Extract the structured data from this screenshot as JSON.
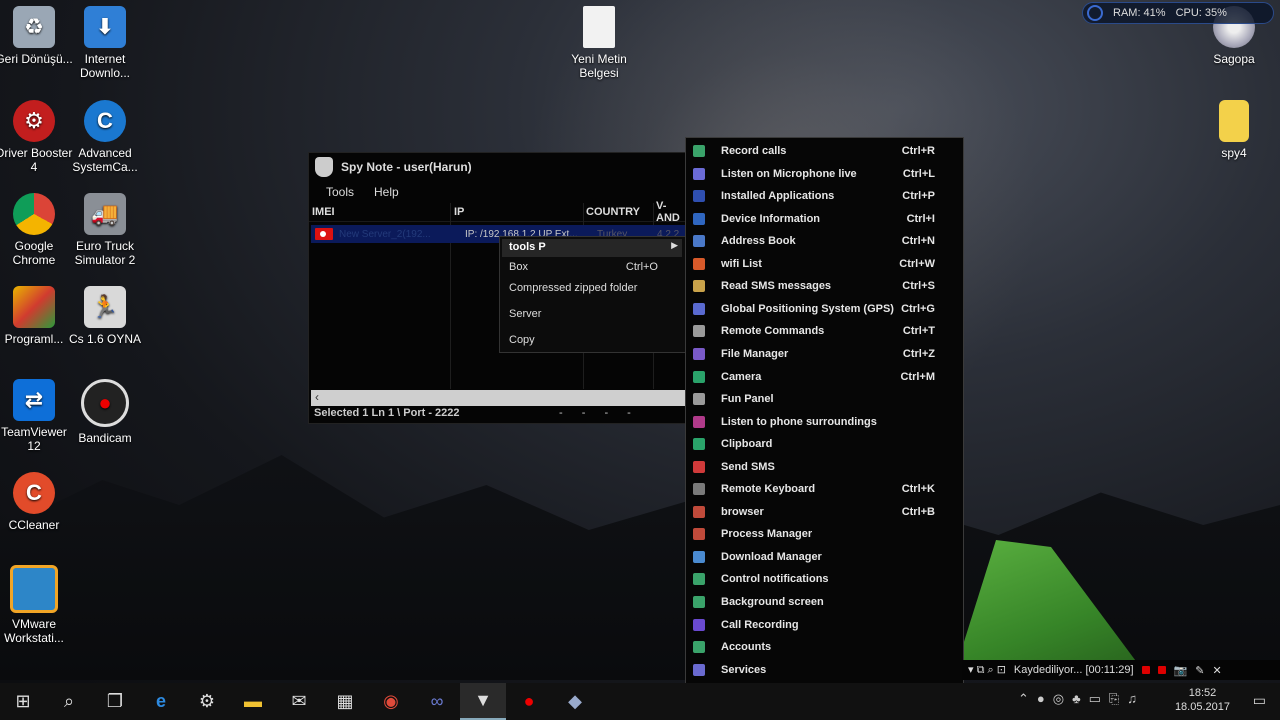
{
  "desktop_icons": [
    {
      "label": "Geri Dönüşü...",
      "icon": "recycle-bin-icon"
    },
    {
      "label": "Internet Downlo...",
      "icon": "internet-download-manager-icon"
    },
    {
      "label": "Driver Booster 4",
      "icon": "driver-booster-icon"
    },
    {
      "label": "Advanced SystemCa...",
      "icon": "advanced-systemcare-icon"
    },
    {
      "label": "Google Chrome",
      "icon": "chrome-icon"
    },
    {
      "label": "Euro Truck Simulator 2",
      "icon": "euro-truck-icon"
    },
    {
      "label": "Programl...",
      "icon": "programs-icon"
    },
    {
      "label": "Cs 1.6 OYNA",
      "icon": "counter-strike-icon"
    },
    {
      "label": "TeamViewer 12",
      "icon": "teamviewer-icon"
    },
    {
      "label": "Bandicam",
      "icon": "bandicam-icon"
    },
    {
      "label": "CCleaner",
      "icon": "ccleaner-icon"
    },
    {
      "label": "VMware Workstati...",
      "icon": "vmware-icon"
    },
    {
      "label": "Yeni Metin Belgesi",
      "icon": "text-document-icon"
    },
    {
      "label": "Sagopa",
      "icon": "sagopa-icon"
    },
    {
      "label": "spy4",
      "icon": "winrar-archive-icon"
    }
  ],
  "perf": {
    "ram": "RAM: 41%",
    "cpu": "CPU: 35%"
  },
  "spynote": {
    "title": "Spy Note - user(Harun)",
    "menu": [
      "Tools",
      "Help"
    ],
    "columns": [
      "IMEI",
      "IP",
      "COUNTRY",
      "V-AND"
    ],
    "row": {
      "imei": "New Server_2(192...",
      "ip": "IP: /192.168.1.2 UP Ext...",
      "country": "Turkey",
      "vand": "4.2.2"
    },
    "status": "Selected 1   Ln 1   \\ Port - 2222",
    "status_right": "- - - -"
  },
  "context_menu_1": [
    {
      "label": "tools P",
      "shortcut": "",
      "submenu": true
    },
    {
      "label": "Box",
      "shortcut": "Ctrl+O"
    },
    {
      "label": "Compressed zipped folder",
      "shortcut": ""
    },
    {
      "label": "Server",
      "shortcut": "",
      "submenu": true
    },
    {
      "label": "Copy",
      "shortcut": "",
      "submenu": true
    }
  ],
  "context_menu_2": [
    {
      "label": "Record calls",
      "shortcut": "Ctrl+R",
      "icon": "phone-icon",
      "color": "#3aa36a"
    },
    {
      "label": "Listen on Microphone live",
      "shortcut": "Ctrl+L",
      "icon": "headphones-icon",
      "color": "#6b6bd6"
    },
    {
      "label": "Installed Applications",
      "shortcut": "Ctrl+P",
      "icon": "play-store-icon",
      "color": "#2f4fb0"
    },
    {
      "label": "Device Information",
      "shortcut": "Ctrl+I",
      "icon": "device-info-icon",
      "color": "#2f66c0"
    },
    {
      "label": "Address Book",
      "shortcut": "Ctrl+N",
      "icon": "address-book-icon",
      "color": "#4a78c8"
    },
    {
      "label": "wifi List",
      "shortcut": "Ctrl+W",
      "icon": "wifi-icon",
      "color": "#d85a2a"
    },
    {
      "label": "Read SMS  messages",
      "shortcut": "Ctrl+S",
      "icon": "envelope-icon",
      "color": "#c9a24a"
    },
    {
      "label": "Global Positioning System (GPS)",
      "shortcut": "Ctrl+G",
      "icon": "gps-icon",
      "color": "#5a6ad0"
    },
    {
      "label": "Remote Commands",
      "shortcut": "Ctrl+T",
      "icon": "braces-icon",
      "color": "#9a9a9a"
    },
    {
      "label": "File Manager",
      "shortcut": "Ctrl+Z",
      "icon": "folder-icon",
      "color": "#7a5ac8"
    },
    {
      "label": "Camera",
      "shortcut": "Ctrl+M",
      "icon": "camera-icon",
      "color": "#2aa36a"
    },
    {
      "label": "Fun Panel",
      "shortcut": "",
      "icon": "ghost-icon",
      "color": "#9a9a9a"
    },
    {
      "label": "Listen to phone surroundings",
      "shortcut": "",
      "icon": "microphone-icon",
      "color": "#b03a8a"
    },
    {
      "label": "Clipboard",
      "shortcut": "",
      "icon": "clipboard-icon",
      "color": "#2aa36a"
    },
    {
      "label": "Send SMS",
      "shortcut": "",
      "icon": "sms-card-icon",
      "color": "#d03a3a"
    },
    {
      "label": "Remote Keyboard",
      "shortcut": "Ctrl+K",
      "icon": "keypad-icon",
      "color": "#7a7a7a"
    },
    {
      "label": "browser",
      "shortcut": "Ctrl+B",
      "icon": "globe-icon",
      "color": "#c04a3a"
    },
    {
      "label": "Process Manager",
      "shortcut": "",
      "icon": "gear-icon",
      "color": "#c04a3a"
    },
    {
      "label": "Download Manager",
      "shortcut": "",
      "icon": "cloud-download-icon",
      "color": "#4a8ad0"
    },
    {
      "label": "Control notifications",
      "shortcut": "",
      "icon": "magnet-icon",
      "color": "#3aa36a"
    },
    {
      "label": "Background screen",
      "shortcut": "",
      "icon": "wallpaper-icon",
      "color": "#3aa36a"
    },
    {
      "label": "Call Recording",
      "shortcut": "",
      "icon": "record-circle-icon",
      "color": "#6a4ad0"
    },
    {
      "label": "Accounts",
      "shortcut": "",
      "icon": "key-icon",
      "color": "#3aa36a"
    },
    {
      "label": "Services",
      "shortcut": "",
      "icon": "gears-icon",
      "color": "#6a6ad0"
    }
  ],
  "recording": {
    "text": "Kaydediliyor... [00:11:29]"
  },
  "clock": {
    "time": "18:52",
    "date": "18.05.2017"
  }
}
